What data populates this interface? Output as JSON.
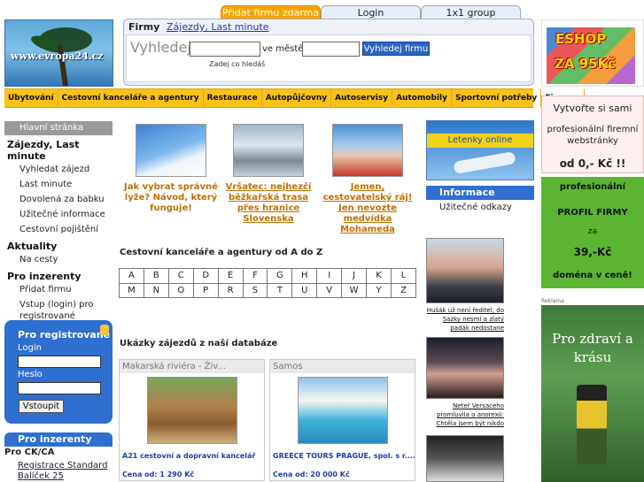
{
  "logo": {
    "text": "www.evropa24.cz"
  },
  "top_tabs": {
    "add_company": "Přidat firmu zdarma",
    "login": "Login",
    "group": "1x1 group"
  },
  "search": {
    "firmy_label": "Firmy",
    "zajezdy_link": "Zájezdy, Last minute",
    "prompt": "Vyhledej",
    "city_label": "ve městě",
    "button": "Vyhledej firmu",
    "hint": "Zadej co hledáš"
  },
  "categories": [
    "Ubytování",
    "Cestovní kanceláře a agentury",
    "Restaurace",
    "Autopůjčovny",
    "Autoservisy",
    "Automobily",
    "Sportovní potřeby",
    "Finance"
  ],
  "sidebar": {
    "home": "Hlavní stránka",
    "sec_zajezdy": "Zájezdy, Last minute",
    "zajezdy_items": [
      "Vyhledat zájezd",
      "Last minute",
      "Dovolená za babku",
      "Užitečné informace",
      "Cestovní pojištění"
    ],
    "sec_aktuality": "Aktuality",
    "aktuality_items": [
      "Na cesty"
    ],
    "sec_inzerenty": "Pro inzerenty",
    "inzerenty_items": [
      "Přidat firmu",
      "Vstup (login) pro registrované"
    ]
  },
  "login": {
    "title": "Pro registrované",
    "login_label": "Login",
    "password_label": "Heslo",
    "button": "Vstoupit"
  },
  "inzerenty_box": {
    "title": "Pro inzerenty",
    "subtitle": "Pro CK/CA",
    "link": "Registrace Standard Balíček 25"
  },
  "featured": [
    {
      "text": "Jak vybrat správné lyže? Návod, který funguje!"
    },
    {
      "text": "Vršatec: nejhezčí běžkařská trasa přes hranice Slovenska"
    },
    {
      "text": "Jemen, cestovatelský ráj! Jen nevozte medvídka Mohameda"
    }
  ],
  "az": {
    "title": "Cestovní kanceláře a agentury od A do Z",
    "row1": [
      "A",
      "B",
      "C",
      "D",
      "E",
      "F",
      "G",
      "H",
      "I",
      "J",
      "K",
      "L"
    ],
    "row2": [
      "M",
      "N",
      "O",
      "P",
      "R",
      "S",
      "T",
      "U",
      "V",
      "W",
      "Y",
      "Z"
    ]
  },
  "examples": {
    "title": "Ukázky zájezdů z naší databáze",
    "items": [
      {
        "destination": "Makarská riviéra - Živ...",
        "agency": "A21 cestovní a dopravní kancelář",
        "price": "Cena od: 1 290 Kč"
      },
      {
        "destination": "Samos",
        "agency": "GREECE TOURS PRAGUE, spol. s r....",
        "price": "Cena od: 20 000 Kč"
      }
    ]
  },
  "right_col": {
    "letenky": "Letenky online",
    "info_title": "Informace",
    "info_link": "Užitečné odkazy",
    "news": [
      "Hušák už není ředitel, do Sazky nesmí a zlatý padák nedostane",
      "Neteř Versaceho promluvila o anorexii: Chtěla jsem být nikdo"
    ]
  },
  "ads": {
    "eshop_line1": "ESHOP",
    "eshop_line2": "ZA 95Kč",
    "web_a": "Vytvořte si sami",
    "web_b": "profesionální firemní webstránky",
    "web_c": "od 0,- Kč !!",
    "profil_a": "profesionální",
    "profil_b": "PROFIL FIRMY",
    "profil_c": "za",
    "profil_d": "39,-Kč",
    "profil_e": "doména v ceně!",
    "reklama": "Reklama",
    "ad_text": "Pro zdraví a krásu"
  }
}
